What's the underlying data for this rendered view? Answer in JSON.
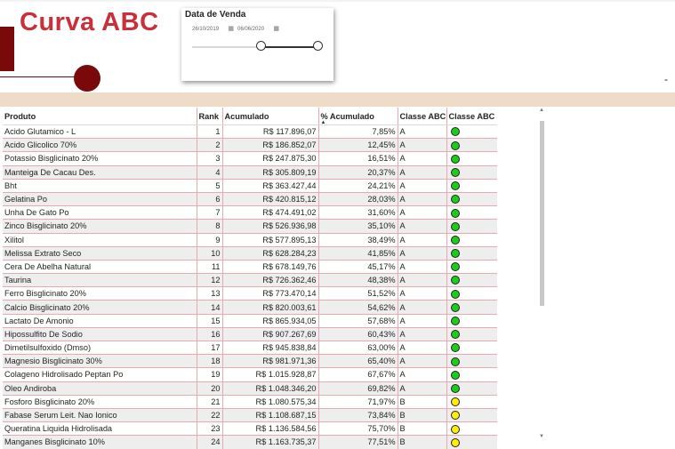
{
  "page": {
    "title": "Curva ABC",
    "dash": "-"
  },
  "slicer": {
    "title": "Data de Venda",
    "start_date": "26/10/2019",
    "end_date": "06/06/2020",
    "range_fraction": [
      0.55,
      1.0
    ]
  },
  "table": {
    "headers": [
      "Produto",
      "Rank",
      "Acumulado",
      "% Acumulado",
      "Classe ABC",
      "Classe ABC"
    ],
    "colors": {
      "A": "#1bcc1b",
      "B": "#ffee00"
    },
    "rows": [
      [
        "Acido Glutamico - L",
        "1",
        "R$ 117.896,07",
        "7,85%",
        "A"
      ],
      [
        "Acido Glicolico 70%",
        "2",
        "R$ 186.852,07",
        "12,45%",
        "A"
      ],
      [
        "Potassio Bisglicinato 20%",
        "3",
        "R$ 247.875,30",
        "16,51%",
        "A"
      ],
      [
        "Manteiga De Cacau Des.",
        "4",
        "R$ 305.809,19",
        "20,37%",
        "A"
      ],
      [
        "Bht",
        "5",
        "R$ 363.427,44",
        "24,21%",
        "A"
      ],
      [
        "Gelatina Po",
        "6",
        "R$ 420.815,12",
        "28,03%",
        "A"
      ],
      [
        "Unha De Gato Po",
        "7",
        "R$ 474.491,02",
        "31,60%",
        "A"
      ],
      [
        "Zinco Bisglicinato 20%",
        "8",
        "R$ 526.936,98",
        "35,10%",
        "A"
      ],
      [
        "Xilitol",
        "9",
        "R$ 577.895,13",
        "38,49%",
        "A"
      ],
      [
        "Melissa Extrato Seco",
        "10",
        "R$ 628.284,23",
        "41,85%",
        "A"
      ],
      [
        "Cera De Abelha Natural",
        "11",
        "R$ 678.149,76",
        "45,17%",
        "A"
      ],
      [
        "Taurina",
        "12",
        "R$ 726.362,46",
        "48,38%",
        "A"
      ],
      [
        "Ferro Bisglicinato 20%",
        "13",
        "R$ 773.470,14",
        "51,52%",
        "A"
      ],
      [
        "Calcio Bisglicinato 20%",
        "14",
        "R$ 820.003,61",
        "54,62%",
        "A"
      ],
      [
        "Lactato De Amonio",
        "15",
        "R$ 865.934,05",
        "57,68%",
        "A"
      ],
      [
        "Hipossulfito De Sodio",
        "16",
        "R$ 907.267,69",
        "60,43%",
        "A"
      ],
      [
        "Dimetilsulfoxido (Dmso)",
        "17",
        "R$ 945.838,84",
        "63,00%",
        "A"
      ],
      [
        "Magnesio Bisglicinato 30%",
        "18",
        "R$ 981.971,36",
        "65,40%",
        "A"
      ],
      [
        "Colageno Hidrolisado Peptan Po",
        "19",
        "R$ 1.015.928,87",
        "67,67%",
        "A"
      ],
      [
        "Oleo Andiroba",
        "20",
        "R$ 1.048.346,20",
        "69,82%",
        "A"
      ],
      [
        "Fosforo Bisglicinato 20%",
        "21",
        "R$ 1.080.575,34",
        "71,97%",
        "B"
      ],
      [
        "Fabase Serum Leit. Nao Ionico",
        "22",
        "R$ 1.108.687,15",
        "73,84%",
        "B"
      ],
      [
        "Queratina Liquida Hidrolisada",
        "23",
        "R$ 1.136.584,56",
        "75,70%",
        "B"
      ],
      [
        "Manganes Bisglicinato 10%",
        "24",
        "R$ 1.163.735,37",
        "77,51%",
        "B"
      ]
    ]
  },
  "scrollbar": {
    "up_arrow": "▲",
    "down_arrow": "▼"
  }
}
